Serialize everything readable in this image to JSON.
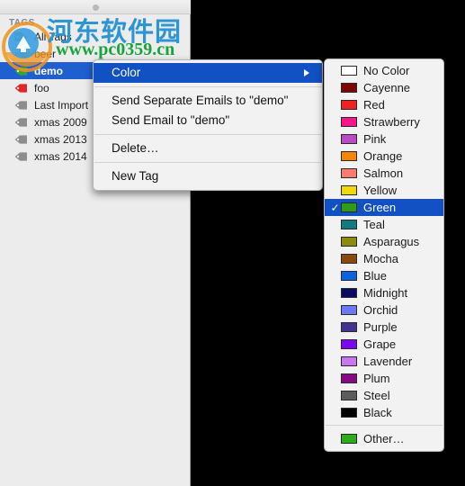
{
  "window": {
    "title_dot": "window-resize-dot"
  },
  "sidebar": {
    "header": "TAGS",
    "items": [
      {
        "label": "All Tags",
        "icon": "tags-stack-icon",
        "color": "#8d8d8d",
        "selected": false
      },
      {
        "label": "beer",
        "icon": "tag-icon",
        "color": "#f2a0b0",
        "selected": false
      },
      {
        "label": "demo",
        "icon": "tag-icon",
        "color": "#2ea82e",
        "selected": true
      },
      {
        "label": "foo",
        "icon": "tag-icon",
        "color": "#e0252b",
        "selected": false
      },
      {
        "label": "Last Import",
        "icon": "tag-icon",
        "color": "#8d8d8d",
        "selected": false
      },
      {
        "label": "xmas 2009",
        "icon": "tag-icon",
        "color": "#8d8d8d",
        "selected": false
      },
      {
        "label": "xmas 2013",
        "icon": "tag-icon",
        "color": "#8d8d8d",
        "selected": false
      },
      {
        "label": "xmas 2014",
        "icon": "tag-icon",
        "color": "#8d8d8d",
        "selected": false
      }
    ]
  },
  "context_menu": {
    "items": [
      {
        "label": "Color",
        "highlight": true,
        "submenu": true
      },
      {
        "label": "Send Separate Emails to \"demo\"",
        "highlight": false,
        "submenu": false
      },
      {
        "label": "Send Email to \"demo\"",
        "highlight": false,
        "submenu": false
      },
      {
        "label": "Delete…",
        "highlight": false,
        "submenu": false
      },
      {
        "label": "New Tag",
        "highlight": false,
        "submenu": false
      }
    ]
  },
  "color_menu": {
    "items": [
      {
        "label": "No Color",
        "swatch": "#ffffff",
        "checked": false
      },
      {
        "label": "Cayenne",
        "swatch": "#7c0707",
        "checked": false
      },
      {
        "label": "Red",
        "swatch": "#ee2222",
        "checked": false
      },
      {
        "label": "Strawberry",
        "swatch": "#f8158c",
        "checked": false
      },
      {
        "label": "Pink",
        "swatch": "#bb4ac6",
        "checked": false
      },
      {
        "label": "Orange",
        "swatch": "#f58505",
        "checked": false
      },
      {
        "label": "Salmon",
        "swatch": "#fb7b6e",
        "checked": false
      },
      {
        "label": "Yellow",
        "swatch": "#efd911",
        "checked": false
      },
      {
        "label": "Green",
        "swatch": "#2f9c17",
        "checked": true
      },
      {
        "label": "Teal",
        "swatch": "#137a7f",
        "checked": false
      },
      {
        "label": "Asparagus",
        "swatch": "#8c8a10",
        "checked": false
      },
      {
        "label": "Mocha",
        "swatch": "#8a4a0d",
        "checked": false
      },
      {
        "label": "Blue",
        "swatch": "#0a62e0",
        "checked": false
      },
      {
        "label": "Midnight",
        "swatch": "#0a0a62",
        "checked": false
      },
      {
        "label": "Orchid",
        "swatch": "#6d78f7",
        "checked": false
      },
      {
        "label": "Purple",
        "swatch": "#443391",
        "checked": false
      },
      {
        "label": "Grape",
        "swatch": "#7a09f0",
        "checked": false
      },
      {
        "label": "Lavender",
        "swatch": "#c877ef",
        "checked": false
      },
      {
        "label": "Plum",
        "swatch": "#850a85",
        "checked": false
      },
      {
        "label": "Steel",
        "swatch": "#5c5c5c",
        "checked": false
      },
      {
        "label": "Black",
        "swatch": "#000000",
        "checked": false
      }
    ],
    "other": {
      "label": "Other…",
      "swatch": "#2cae1c"
    },
    "check_glyph": "✓"
  },
  "watermark": {
    "cn_text": "河东软件园",
    "url_text": "www.pc0359.cn"
  },
  "colors": {
    "selection_blue": "#1f5fd0",
    "menu_highlight_blue": "#1251c4",
    "panel_bg": "#ececec",
    "menu_bg": "#f2f2f2",
    "watermark_blue": "#2e95d3",
    "watermark_green": "#19a33f"
  }
}
